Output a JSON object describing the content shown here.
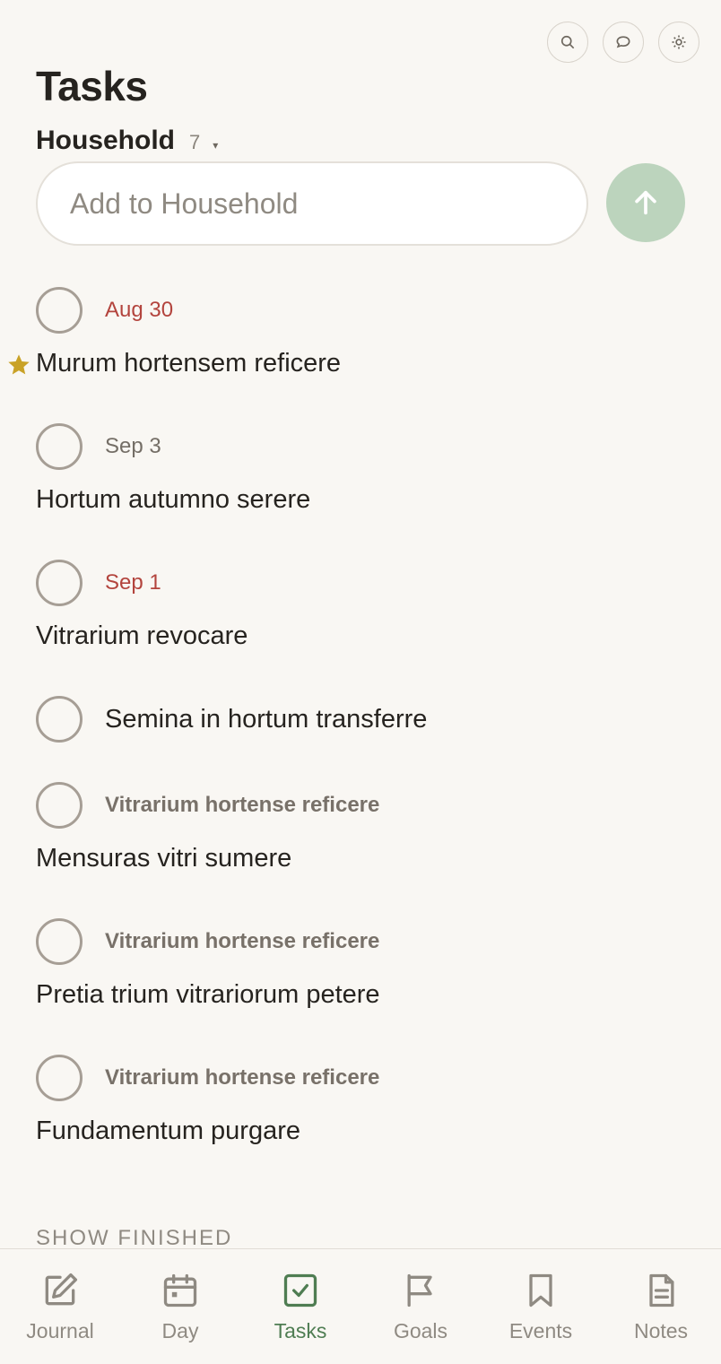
{
  "header": {
    "title": "Tasks",
    "list_name": "Household",
    "list_count": "7",
    "caret": "▾"
  },
  "add_input": {
    "placeholder": "Add to Household"
  },
  "colors": {
    "accent": "#4f7d52",
    "send_button": "#bcd4bd",
    "overdue": "#b3443d",
    "star": "#c9a227",
    "background": "#f9f7f3"
  },
  "tasks": [
    {
      "meta": "Aug 30",
      "meta_type": "overdue",
      "title": "Murum hortensem reficere",
      "starred": true
    },
    {
      "meta": "Sep 3",
      "meta_type": "date",
      "title": "Hortum autumno serere",
      "starred": false
    },
    {
      "meta": "Sep 1",
      "meta_type": "overdue",
      "title": "Vitrarium revocare",
      "starred": false
    },
    {
      "meta": "",
      "meta_type": "none",
      "title": "Semina in hortum transferre",
      "starred": false
    },
    {
      "meta": "Vitrarium hortense reficere",
      "meta_type": "parent",
      "title": "Mensuras vitri sumere",
      "starred": false
    },
    {
      "meta": "Vitrarium hortense reficere",
      "meta_type": "parent",
      "title": "Pretia trium vitrariorum petere",
      "starred": false
    },
    {
      "meta": "Vitrarium hortense reficere",
      "meta_type": "parent",
      "title": "Fundamentum purgare",
      "starred": false
    }
  ],
  "show_finished_label": "SHOW FINISHED",
  "nav": {
    "active": "Tasks",
    "items": [
      {
        "label": "Journal",
        "icon": "edit-icon"
      },
      {
        "label": "Day",
        "icon": "calendar-icon"
      },
      {
        "label": "Tasks",
        "icon": "checkbox-icon"
      },
      {
        "label": "Goals",
        "icon": "flag-icon"
      },
      {
        "label": "Events",
        "icon": "bookmark-icon"
      },
      {
        "label": "Notes",
        "icon": "note-icon"
      }
    ]
  }
}
